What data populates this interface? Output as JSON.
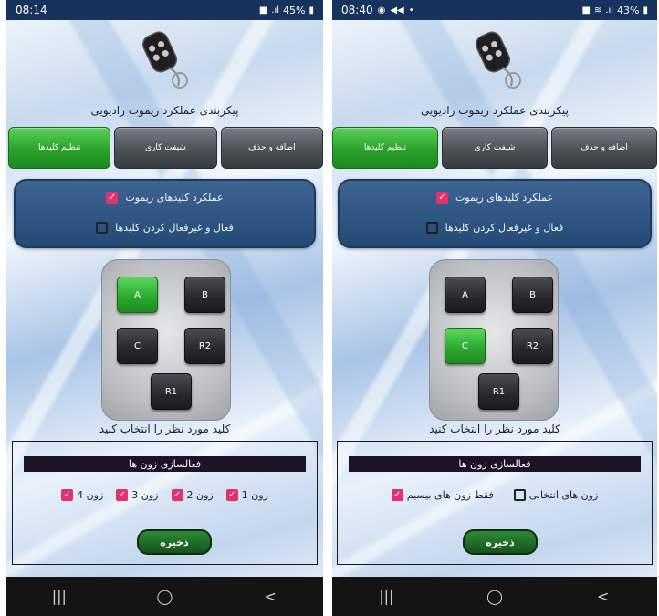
{
  "common": {
    "app_title": "پیکربندی عملکرد ریموت رادیویی",
    "tabs": {
      "add_remove": "اضافه و حذف",
      "shift": "شیفت کاری",
      "key_settings": "تنظیم کلیدها"
    },
    "options": {
      "remote_keys_function": "عملکرد کلیدهای ریموت",
      "enable_disable_keys": "فعال و غیرفعال کردن کلیدها"
    },
    "keys": {
      "a": "A",
      "b": "B",
      "c": "C",
      "r2": "R2",
      "r1": "R1"
    },
    "select_key_hint": "کلید مورد نظر را انتخاب کنید",
    "zone_header": "فعالسازی زون ها",
    "save": "ذخیره",
    "nav": {
      "recents": "|||",
      "home": "◯",
      "back": "<"
    }
  },
  "left_screen": {
    "status": {
      "time": "08:14",
      "battery": "45%"
    },
    "selected_key": "A",
    "zones": [
      "زون 1",
      "زون 2",
      "زون 3",
      "زون 4"
    ]
  },
  "right_screen": {
    "status": {
      "time": "08:40",
      "battery": "43%"
    },
    "selected_key": "C",
    "zone_options": {
      "selected_zones": "زون های انتخابی",
      "wireless_only": "فقط زون های بیسیم"
    }
  },
  "colors": {
    "accent_green": "#2aa12a",
    "checkbox_pink": "#e5316b",
    "status_bar": "#17335d",
    "nav_bar": "#141414"
  }
}
